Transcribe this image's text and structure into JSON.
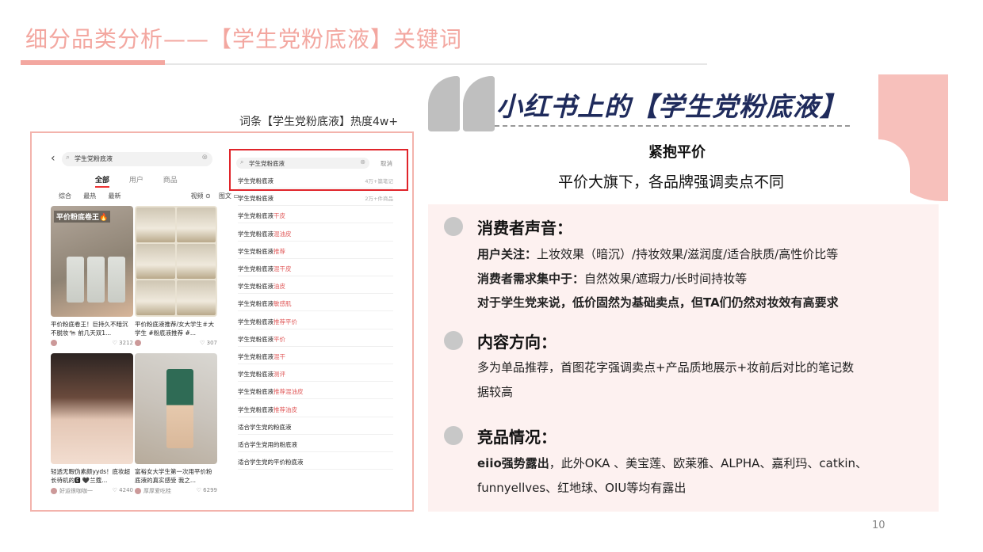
{
  "title": "细分品类分析——【学生党粉底液】关键词",
  "caption": "词条【学生党粉底液】热度4w+",
  "phone": {
    "search_text": "学生党粉底液",
    "tabs": [
      "全部",
      "用户",
      "商品"
    ],
    "filters": [
      "综合",
      "最热",
      "最新"
    ],
    "filter_right": [
      "视频",
      "图文"
    ],
    "cards": [
      {
        "badge": "平价粉底卷王🔥",
        "text": "平价粉底卷王！巨持久不暗沉不脱妆🐄 前几天双1...",
        "likes": "3212"
      },
      {
        "badge": "",
        "text": "平价粉底液推荐/女大学生＃大学生 #粉底液推荐 #...",
        "likes": "307"
      },
      {
        "badge": "",
        "text": "轻透无暇伪素颜yyds！底妆超长待机的🅴 🖤兰蔻...",
        "user": "好运很咖咖一",
        "likes": "4240"
      },
      {
        "badge": "",
        "text": "富裕女大学生第一次用平价粉底液的真实感受 我之...",
        "user": "厚厚爱吃桂",
        "likes": "6299"
      }
    ],
    "search2_text": "学生党粉底液",
    "cancel": "取消",
    "suggestions": [
      {
        "prefix": "学生党粉底液",
        "suffix": "",
        "count": "4万+篇笔记"
      },
      {
        "prefix": "学生党粉底液",
        "suffix": "",
        "count": "2万+件商品"
      },
      {
        "prefix": "学生党粉底液",
        "suffix": "干皮",
        "count": ""
      },
      {
        "prefix": "学生党粉底液",
        "suffix": "混油皮",
        "count": ""
      },
      {
        "prefix": "学生党粉底液",
        "suffix": "推荐",
        "count": ""
      },
      {
        "prefix": "学生党粉底液",
        "suffix": "混干皮",
        "count": ""
      },
      {
        "prefix": "学生党粉底液",
        "suffix": "油皮",
        "count": ""
      },
      {
        "prefix": "学生党粉底液",
        "suffix": "敏感肌",
        "count": ""
      },
      {
        "prefix": "学生党粉底液",
        "suffix": "推荐平价",
        "count": ""
      },
      {
        "prefix": "学生党粉底液",
        "suffix": "平价",
        "count": ""
      },
      {
        "prefix": "学生党粉底液",
        "suffix": "混干",
        "count": ""
      },
      {
        "prefix": "学生党粉底液",
        "suffix": "测评",
        "count": ""
      },
      {
        "prefix": "学生党粉底液",
        "suffix": "推荐混油皮",
        "count": ""
      },
      {
        "prefix": "学生党粉底液",
        "suffix": "推荐油皮",
        "count": ""
      },
      {
        "prefix": "适合学生党的粉底液",
        "suffix": "",
        "count": ""
      },
      {
        "prefix": "适合学生党用的粉底液",
        "suffix": "",
        "count": ""
      },
      {
        "prefix": "适合学生党的平价粉底液",
        "suffix": "",
        "count": ""
      }
    ]
  },
  "headline": "小红书上的【学生党粉底液】",
  "sub1": "紧抱平价",
  "sub2": "平价大旗下，各品牌强调卖点不同",
  "sections": [
    {
      "heading": "消费者声音：",
      "l1_label": "用户关注：",
      "l1_text": "上妆效果（暗沉）/持妆效果/滋润度/适合肤质/高性价比等",
      "l2_label": "消费者需求集中于：",
      "l2_text": "自然效果/遮瑕力/长时间持妆等",
      "l3": "对于学生党来说，低价固然为基础卖点，但TA们仍然对妆效有高要求"
    },
    {
      "heading": "内容方向：",
      "l1": "多为单品推荐，首图花字强调卖点+产品质地展示+妆前后对比的笔记数",
      "l2": "据较高"
    },
    {
      "heading": "竞品情况：",
      "l1_label": "eiio强势露出",
      "l1_text": "，此外OKA 、美宝莲、欧莱雅、ALPHA、嘉利玛、catkin、",
      "l2": "funnyellves、红地球、OIU等均有露出"
    }
  ],
  "page_number": "10",
  "colors": {
    "accent": "#f3a7a0",
    "headline": "#1f2b5c",
    "highlight": "#e0242a",
    "panel": "#fdf1f0"
  }
}
